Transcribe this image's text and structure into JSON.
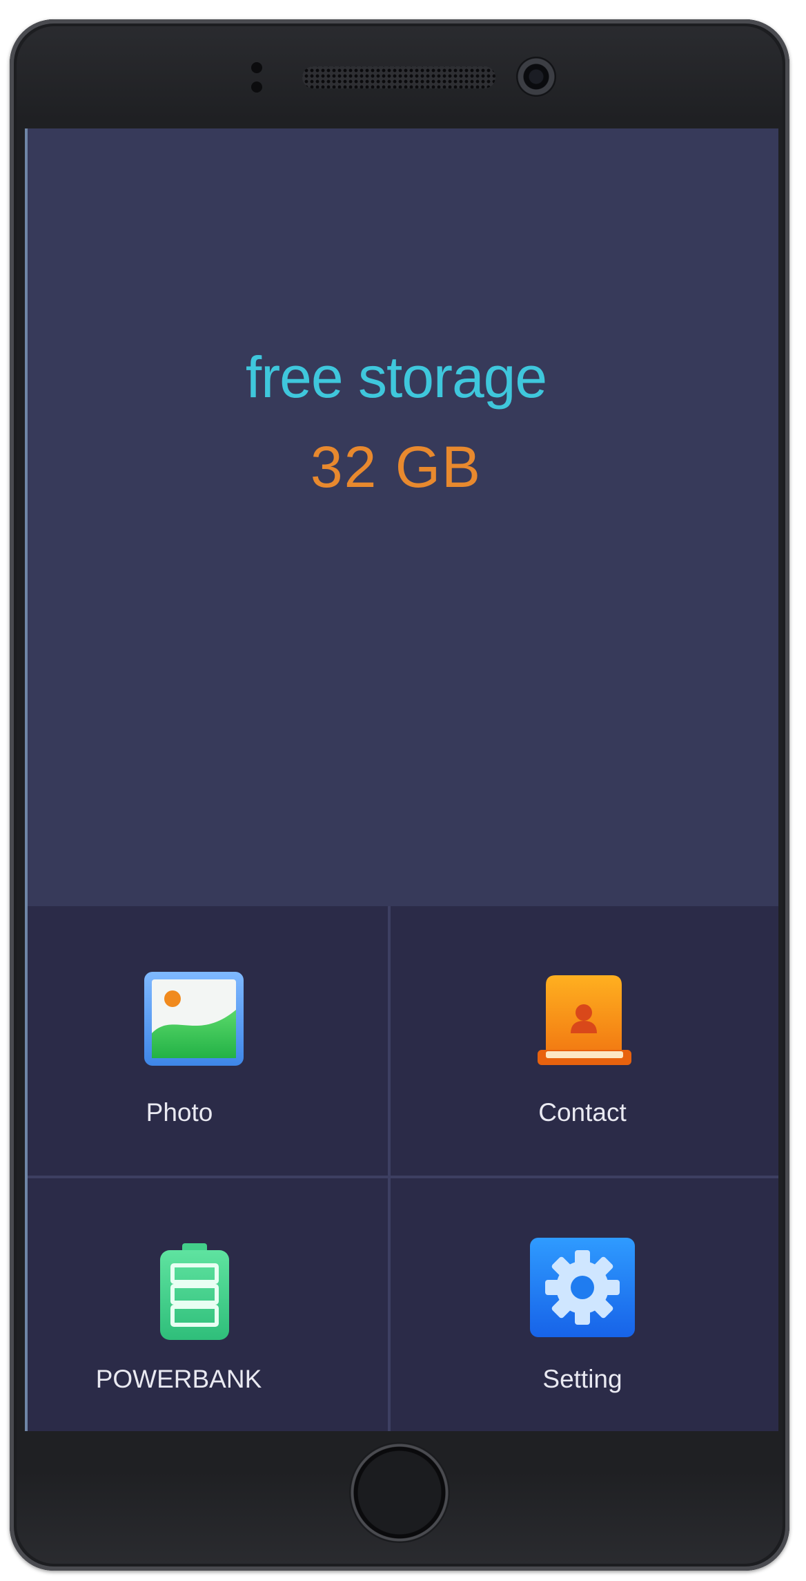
{
  "storage": {
    "label": "free storage",
    "value": "32 GB"
  },
  "apps": [
    {
      "label": "Photo",
      "icon": "photo-icon"
    },
    {
      "label": "Contact",
      "icon": "contact-book-icon"
    },
    {
      "label": "POWERBANK",
      "icon": "battery-icon"
    },
    {
      "label": "Setting",
      "icon": "gear-icon"
    }
  ],
  "colors": {
    "screen_background": "#373a5a",
    "grid_background": "#2b2b48",
    "storage_label": "#3fc7dc",
    "storage_value": "#e8892e",
    "app_label": "#e9e9f1"
  }
}
